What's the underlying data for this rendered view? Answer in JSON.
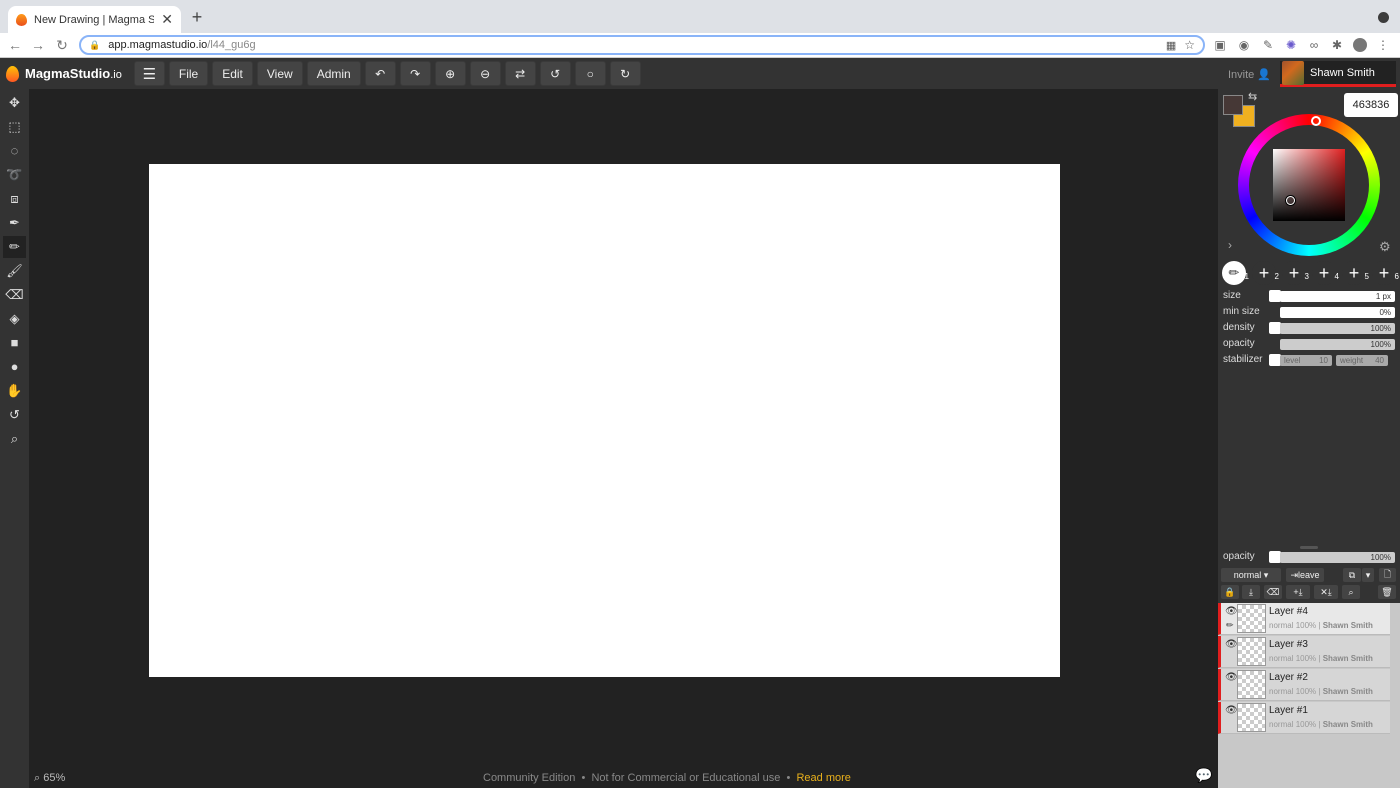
{
  "browser": {
    "tab_title": "New Drawing | Magma Studio",
    "url_host": "app.magmastudio.io",
    "url_path": "/l44_gu6g"
  },
  "app": {
    "logo": "MagmaStudio",
    "logo_suffix": ".io",
    "menu": {
      "file": "File",
      "edit": "Edit",
      "view": "View",
      "admin": "Admin"
    },
    "zoom": "65%",
    "footer": {
      "edition": "Community Edition",
      "sep": "•",
      "notice": "Not for Commercial or Educational use",
      "read_more": "Read more"
    }
  },
  "panel": {
    "invite": "Invite",
    "user_name": "Shawn Smith",
    "hex": "463836",
    "primary_color": "#463836",
    "secondary_color": "#f0b020",
    "brush_slots": [
      "1",
      "2",
      "3",
      "4",
      "5",
      "6"
    ],
    "labels": {
      "size": "size",
      "min_size": "min size",
      "density": "density",
      "opacity": "opacity",
      "stabilizer": "stabilizer"
    },
    "values": {
      "size": "1 px",
      "min_size": "0%",
      "density": "100%",
      "opacity": "100%",
      "level_label": "level",
      "level": "10",
      "weight_label": "weight",
      "weight": "40"
    },
    "layer_opacity_label": "opacity",
    "layer_opacity": "100%",
    "blend_mode": "normal",
    "leave": "leave",
    "layers": [
      {
        "name": "Layer #4",
        "mode": "normal",
        "opacity": "100%",
        "owner": "Shawn Smith"
      },
      {
        "name": "Layer #3",
        "mode": "normal",
        "opacity": "100%",
        "owner": "Shawn Smith"
      },
      {
        "name": "Layer #2",
        "mode": "normal",
        "opacity": "100%",
        "owner": "Shawn Smith"
      },
      {
        "name": "Layer #1",
        "mode": "normal",
        "opacity": "100%",
        "owner": "Shawn Smith"
      }
    ]
  }
}
